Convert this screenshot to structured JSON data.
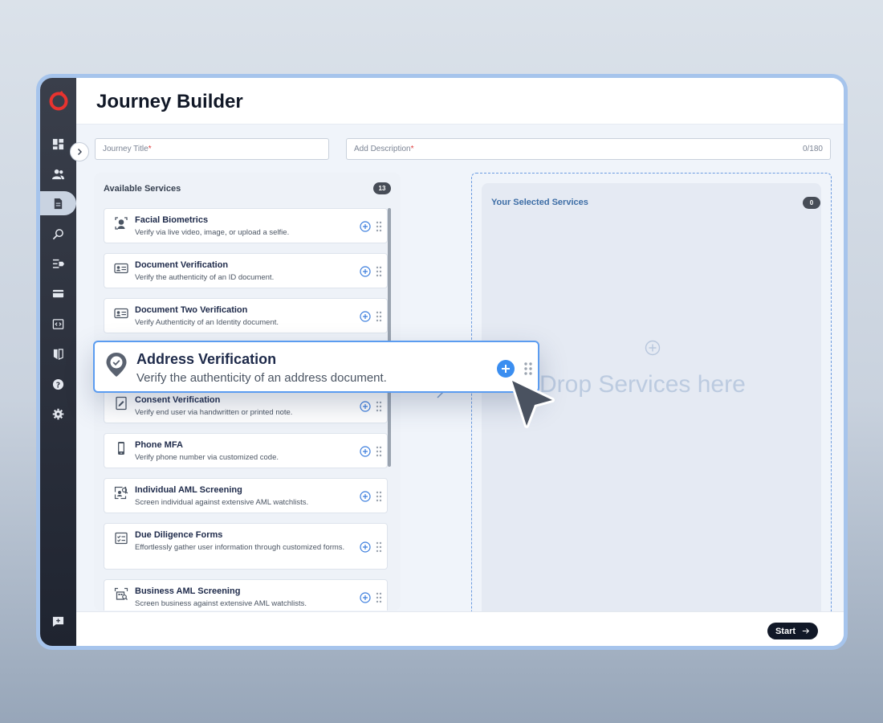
{
  "app": {
    "title": "Journey Builder"
  },
  "form": {
    "journey_title_placeholder": "Journey Title",
    "description_placeholder": "Add Description",
    "required_mark": "*",
    "description_counter": "0/180"
  },
  "available": {
    "title": "Available Services",
    "count": "13",
    "items": [
      {
        "name": "Facial Biometrics",
        "desc": "Verify via live video, image, or upload a selfie.",
        "icon": "face-scan-icon"
      },
      {
        "name": "Document Verification",
        "desc": "Verify the authenticity of an ID document.",
        "icon": "id-card-icon"
      },
      {
        "name": "Document Two Verification",
        "desc": "Verify Authenticity of an Identity document.",
        "icon": "id-card-icon"
      },
      {
        "name": "Consent Verification",
        "desc": "Verify end user via handwritten or printed note.",
        "icon": "consent-note-icon"
      },
      {
        "name": "Phone MFA",
        "desc": "Verify phone number via customized code.",
        "icon": "phone-icon"
      },
      {
        "name": "Individual AML Screening",
        "desc": "Screen individual against extensive AML watchlists.",
        "icon": "person-search-icon"
      },
      {
        "name": "Due Diligence Forms",
        "desc": "Effortlessly gather user information through customized forms.",
        "icon": "form-checklist-icon"
      },
      {
        "name": "Business AML Screening",
        "desc": "Screen business against extensive AML watchlists.",
        "icon": "business-search-icon"
      }
    ]
  },
  "dragging": {
    "name": "Address Verification",
    "desc": "Verify the authenticity of an address document.",
    "icon": "location-check-icon"
  },
  "selected": {
    "title": "Your Selected Services",
    "count": "0",
    "drop_text": "Drop Services here"
  },
  "footer": {
    "start_label": "Start"
  },
  "sidebar_icons": [
    "dashboard-icon",
    "users-icon",
    "journey-document-icon",
    "search-icon",
    "list-tag-icon",
    "card-icon",
    "code-icon",
    "compare-icon",
    "help-icon",
    "settings-icon",
    "feedback-icon"
  ],
  "colors": {
    "accent": "#3b8ef0",
    "brand": "#e8332f",
    "sidebar": "#2a2f3b",
    "drop_border": "#6b9be0"
  }
}
